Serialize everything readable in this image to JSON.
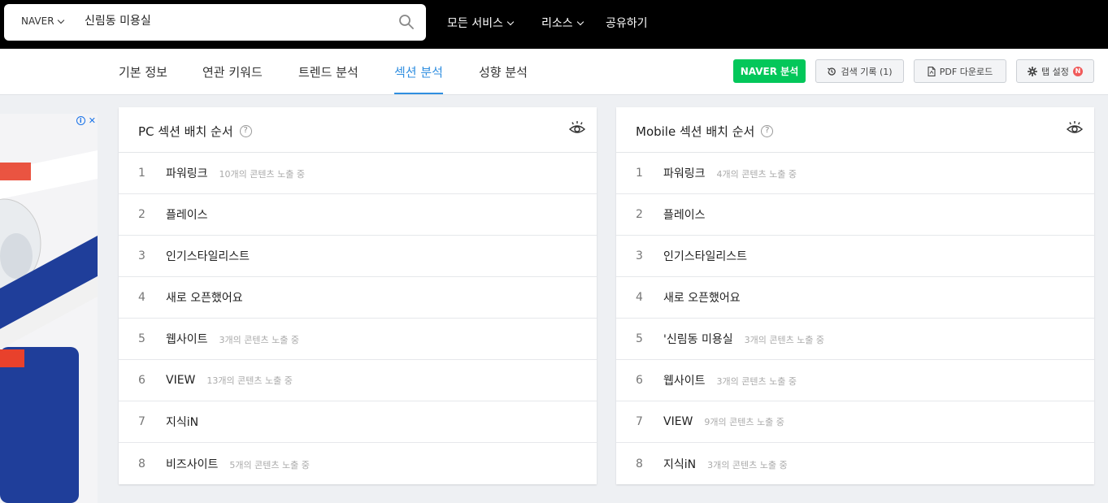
{
  "search": {
    "engine_label": "NAVER",
    "query": "신림동 미용실"
  },
  "top_nav": {
    "all_services": "모든 서비스",
    "resources": "리소스",
    "share": "공유하기"
  },
  "tabs": [
    {
      "label": "기본 정보"
    },
    {
      "label": "연관 키워드"
    },
    {
      "label": "트렌드 분석"
    },
    {
      "label": "섹션 분석"
    },
    {
      "label": "성향 분석"
    }
  ],
  "actions": {
    "naver_analysis": "NAVER 분석",
    "search_history": "검색 기록 (1)",
    "pdf_download": "PDF 다운로드",
    "tab_settings": "탭 설정",
    "tab_settings_badge": "N"
  },
  "ad": {
    "close_label": "✕"
  },
  "pc_panel": {
    "title": "PC 섹션 배치 순서",
    "help": "?",
    "rows": [
      {
        "num": "1",
        "name": "파워링크",
        "sub": "10개의 콘텐츠 노출 중"
      },
      {
        "num": "2",
        "name": "플레이스",
        "sub": ""
      },
      {
        "num": "3",
        "name": "인기스타일리스트",
        "sub": ""
      },
      {
        "num": "4",
        "name": "새로 오픈했어요",
        "sub": ""
      },
      {
        "num": "5",
        "name": "웹사이트",
        "sub": "3개의 콘텐츠 노출 중"
      },
      {
        "num": "6",
        "name": "VIEW",
        "sub": "13개의 콘텐츠 노출 중"
      },
      {
        "num": "7",
        "name": "지식iN",
        "sub": ""
      },
      {
        "num": "8",
        "name": "비즈사이트",
        "sub": "5개의 콘텐츠 노출 중"
      }
    ]
  },
  "mobile_panel": {
    "title": "Mobile 섹션 배치 순서",
    "help": "?",
    "rows": [
      {
        "num": "1",
        "name": "파워링크",
        "sub": "4개의 콘텐츠 노출 중"
      },
      {
        "num": "2",
        "name": "플레이스",
        "sub": ""
      },
      {
        "num": "3",
        "name": "인기스타일리스트",
        "sub": ""
      },
      {
        "num": "4",
        "name": "새로 오픈했어요",
        "sub": ""
      },
      {
        "num": "5",
        "name": "'신림동 미용실",
        "sub": "3개의 콘텐츠 노출 중"
      },
      {
        "num": "6",
        "name": "웹사이트",
        "sub": "3개의 콘텐츠 노출 중"
      },
      {
        "num": "7",
        "name": "VIEW",
        "sub": "9개의 콘텐츠 노출 중"
      },
      {
        "num": "8",
        "name": "지식iN",
        "sub": "3개의 콘텐츠 노출 중"
      }
    ]
  },
  "colors": {
    "accent": "#2f8ee0",
    "naver_green": "#03c75a",
    "topbar": "#000000"
  }
}
